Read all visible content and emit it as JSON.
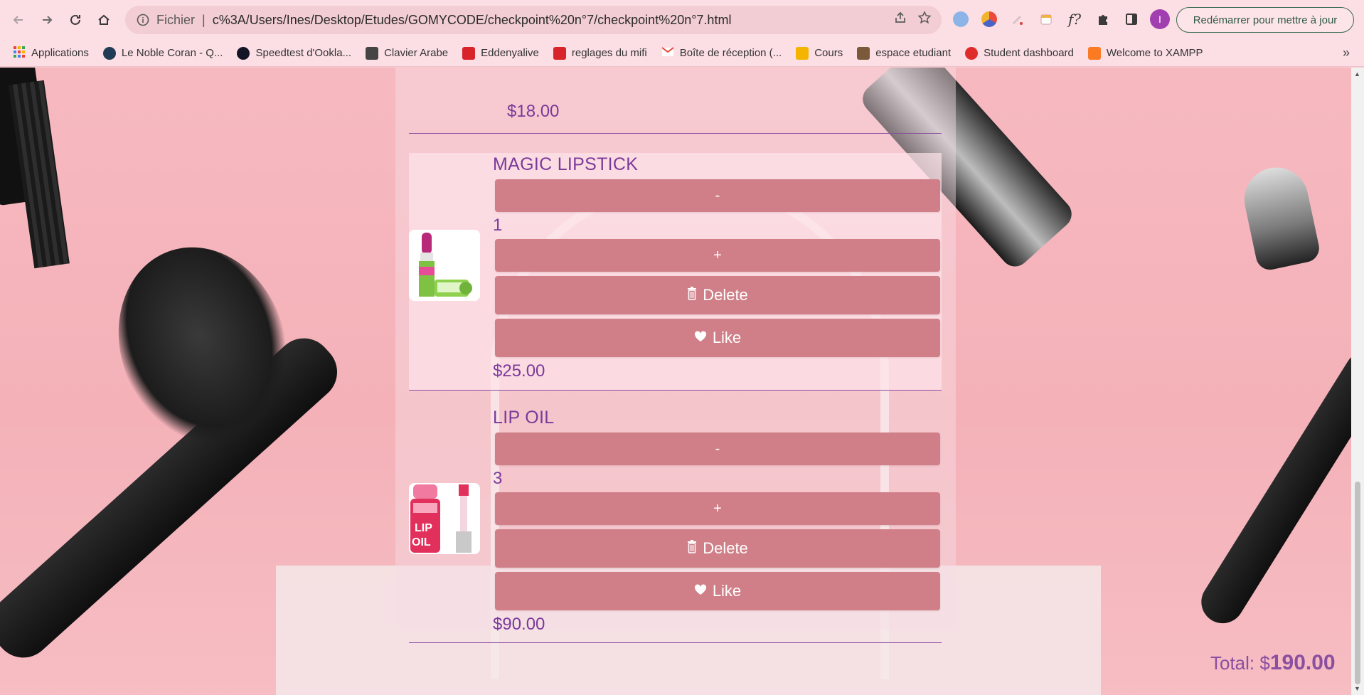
{
  "browser": {
    "url_scheme": "Fichier",
    "url_separator": "|",
    "url": "c%3A/Users/Ines/Desktop/Etudes/GOMYCODE/checkpoint%20n°7/checkpoint%20n°7.html",
    "restart_label": "Redémarrer pour mettre à jour",
    "profile_initial": "I",
    "ext_f_label": "f?",
    "more_label": "»"
  },
  "bookmarks": [
    {
      "label": "Applications",
      "color": "#e8453c"
    },
    {
      "label": "Le Noble Coran - Q...",
      "color": "#1f3b55"
    },
    {
      "label": "Speedtest d'Ookla...",
      "color": "#141526"
    },
    {
      "label": "Clavier Arabe",
      "color": "#444444"
    },
    {
      "label": "Eddenyalive",
      "color": "#d8232a"
    },
    {
      "label": "reglages du mifi",
      "color": "#d8232a"
    },
    {
      "label": "Boîte de réception (...",
      "color": "#ea4335"
    },
    {
      "label": "Cours",
      "color": "#f4b400"
    },
    {
      "label": "espace etudiant",
      "color": "#7a5a3a"
    },
    {
      "label": "Student dashboard",
      "color": "#e02b2b"
    },
    {
      "label": "Welcome to XAMPP",
      "color": "#fb7a24"
    }
  ],
  "cart": {
    "previous_item_price": "$18.00",
    "items": [
      {
        "name": "MAGIC LIPSTICK",
        "quantity": "1",
        "minus_label": "-",
        "plus_label": "+",
        "delete_label": "Delete",
        "like_label": "Like",
        "price": "$25.00"
      },
      {
        "name": "LIP OIL",
        "quantity": "3",
        "minus_label": "-",
        "plus_label": "+",
        "delete_label": "Delete",
        "like_label": "Like",
        "price": "$90.00"
      }
    ],
    "total_label": "Total: $",
    "total_amount": "190.00"
  },
  "icons": {
    "delete": "trash-icon",
    "like": "heart-icon"
  },
  "colors": {
    "accent_text": "#7a3a9a",
    "button_bg": "#d07f88",
    "page_bg": "#f4b1b8"
  }
}
